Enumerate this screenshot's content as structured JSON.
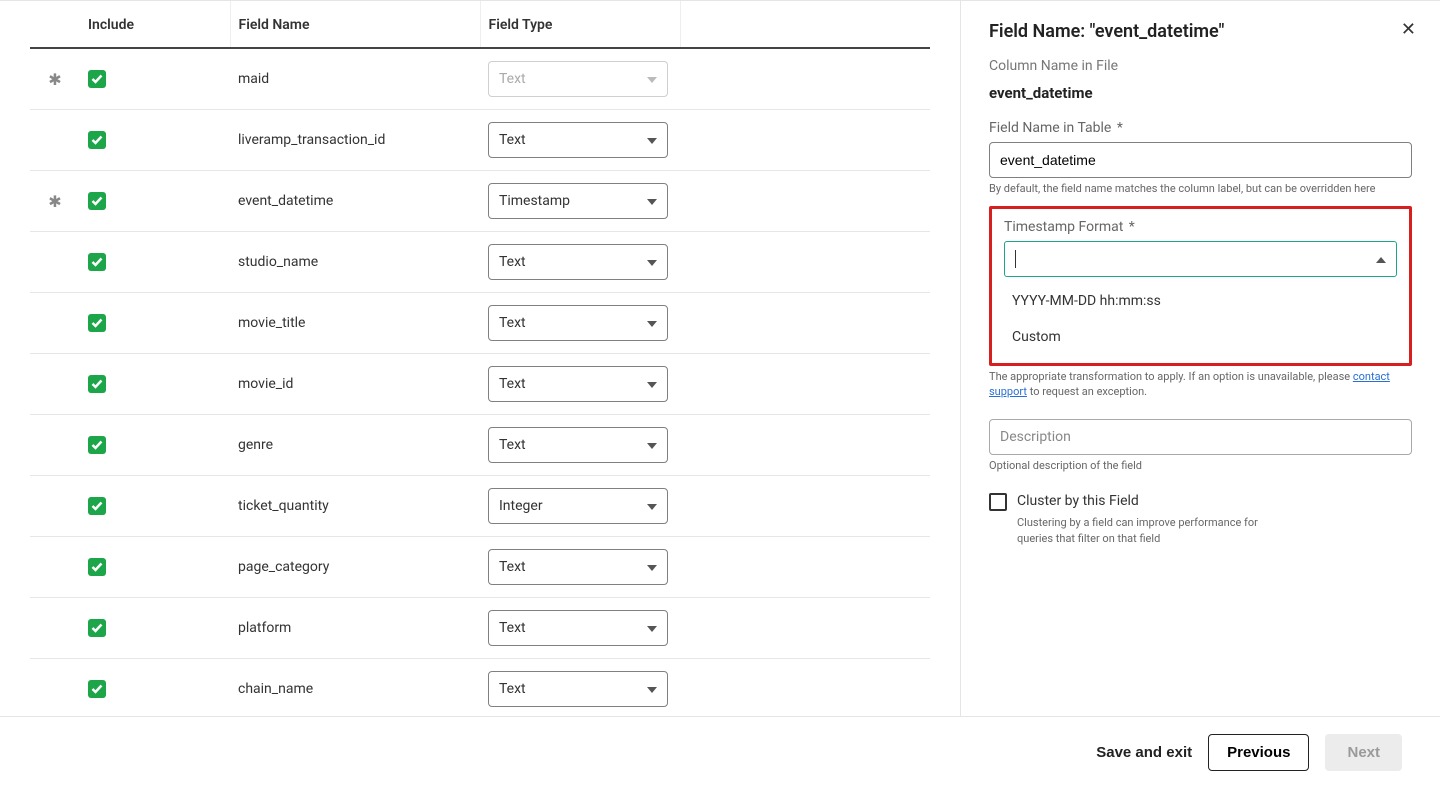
{
  "table": {
    "headers": {
      "include": "Include",
      "fieldname": "Field Name",
      "fieldtype": "Field Type"
    },
    "rows": [
      {
        "star": true,
        "include": true,
        "name": "maid",
        "type": "Text",
        "disabled": true
      },
      {
        "star": false,
        "include": true,
        "name": "liveramp_transaction_id",
        "type": "Text",
        "disabled": false
      },
      {
        "star": true,
        "include": true,
        "name": "event_datetime",
        "type": "Timestamp",
        "disabled": false
      },
      {
        "star": false,
        "include": true,
        "name": "studio_name",
        "type": "Text",
        "disabled": false
      },
      {
        "star": false,
        "include": true,
        "name": "movie_title",
        "type": "Text",
        "disabled": false
      },
      {
        "star": false,
        "include": true,
        "name": "movie_id",
        "type": "Text",
        "disabled": false
      },
      {
        "star": false,
        "include": true,
        "name": "genre",
        "type": "Text",
        "disabled": false
      },
      {
        "star": false,
        "include": true,
        "name": "ticket_quantity",
        "type": "Integer",
        "disabled": false
      },
      {
        "star": false,
        "include": true,
        "name": "page_category",
        "type": "Text",
        "disabled": false
      },
      {
        "star": false,
        "include": true,
        "name": "platform",
        "type": "Text",
        "disabled": false
      },
      {
        "star": false,
        "include": true,
        "name": "chain_name",
        "type": "Text",
        "disabled": false
      }
    ]
  },
  "side": {
    "title": "Field Name: \"event_datetime\"",
    "column_label": "Column Name in File",
    "column_value": "event_datetime",
    "fieldname_label": "Field Name in Table",
    "fieldname_value": "event_datetime",
    "fieldname_hint": "By default, the field name matches the column label, but can be overridden here",
    "ts_label": "Timestamp Format",
    "ts_options": {
      "opt1": "YYYY-MM-DD hh:mm:ss",
      "opt2": "Custom"
    },
    "transform_hint_pre": "The appropriate transformation to apply. If an option is unavailable, please ",
    "transform_link": "contact support",
    "transform_hint_post": " to request an exception.",
    "desc_placeholder": "Description",
    "desc_hint": "Optional description of the field",
    "cluster_label": "Cluster by this Field",
    "cluster_hint": "Clustering by a field can improve performance for queries that filter on that field"
  },
  "footer": {
    "save": "Save and exit",
    "previous": "Previous",
    "next": "Next"
  }
}
